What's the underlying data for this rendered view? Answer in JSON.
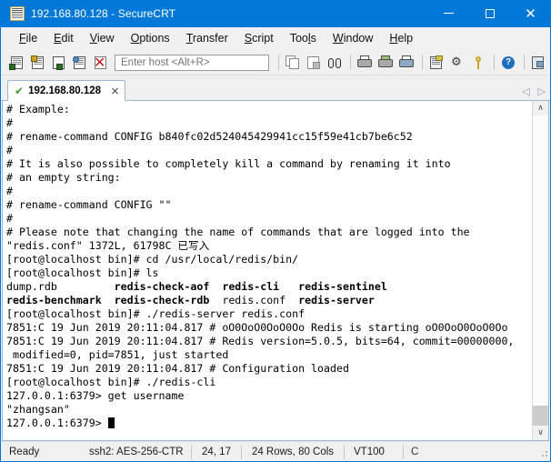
{
  "window": {
    "title": "192.168.80.128 - SecureCRT",
    "icon": "securecrt-icon",
    "minimize_label": "—",
    "maximize_label": "□",
    "close_label": "✕"
  },
  "menu": {
    "items": [
      {
        "label": "File",
        "accel": "F"
      },
      {
        "label": "Edit",
        "accel": "E"
      },
      {
        "label": "View",
        "accel": "V"
      },
      {
        "label": "Options",
        "accel": "O"
      },
      {
        "label": "Transfer",
        "accel": "T"
      },
      {
        "label": "Script",
        "accel": "S"
      },
      {
        "label": "Tools",
        "accel": "l"
      },
      {
        "label": "Window",
        "accel": "W"
      },
      {
        "label": "Help",
        "accel": "H"
      }
    ]
  },
  "toolbar": {
    "host_placeholder": "Enter host <Alt+R>",
    "host_value": "",
    "icons": [
      "new-session-icon",
      "connect-sftp-icon",
      "connect-in-tab-icon",
      "reconnect-icon",
      "disconnect-icon",
      "copy-icon",
      "paste-icon",
      "find-icon",
      "print-icon",
      "print-selection-icon",
      "print-screen-icon",
      "log-session-icon",
      "session-options-icon",
      "key-icon",
      "help-icon",
      "arrange-windows-icon"
    ]
  },
  "tabs": {
    "active": {
      "label": "192.168.80.128",
      "status_icon": "connected-check-icon",
      "close_label": "×"
    },
    "nav_prev": "◁",
    "nav_next": "▷"
  },
  "terminal": {
    "lines": [
      {
        "text": "# Example:"
      },
      {
        "text": "#"
      },
      {
        "text": "# rename-command CONFIG b840fc02d524045429941cc15f59e41cb7be6c52"
      },
      {
        "text": "#"
      },
      {
        "text": "# It is also possible to completely kill a command by renaming it into"
      },
      {
        "text": "# an empty string:"
      },
      {
        "text": "#"
      },
      {
        "text": "# rename-command CONFIG \"\""
      },
      {
        "text": "#"
      },
      {
        "text": "# Please note that changing the name of commands that are logged into the"
      },
      {
        "text": "\"redis.conf\" 1372L, 61798C 已写入"
      },
      {
        "text": "[root@localhost bin]# cd /usr/local/redis/bin/"
      },
      {
        "text": "[root@localhost bin]# ls"
      },
      {
        "segments": [
          {
            "text": "dump.rdb         ",
            "bold": false
          },
          {
            "text": "redis-check-aof",
            "bold": true
          },
          {
            "text": "  ",
            "bold": false
          },
          {
            "text": "redis-cli",
            "bold": true
          },
          {
            "text": "   ",
            "bold": false
          },
          {
            "text": "redis-sentinel",
            "bold": true
          }
        ]
      },
      {
        "segments": [
          {
            "text": "redis-benchmark",
            "bold": true
          },
          {
            "text": "  ",
            "bold": false
          },
          {
            "text": "redis-check-rdb",
            "bold": true
          },
          {
            "text": "  redis.conf  ",
            "bold": false
          },
          {
            "text": "redis-server",
            "bold": true
          }
        ]
      },
      {
        "text": "[root@localhost bin]# ./redis-server redis.conf"
      },
      {
        "text": "7851:C 19 Jun 2019 20:11:04.817 # oO0OoO0OoO0Oo Redis is starting oO0OoO0OoO0Oo"
      },
      {
        "text": "7851:C 19 Jun 2019 20:11:04.817 # Redis version=5.0.5, bits=64, commit=00000000,"
      },
      {
        "text": " modified=0, pid=7851, just started"
      },
      {
        "text": "7851:C 19 Jun 2019 20:11:04.817 # Configuration loaded"
      },
      {
        "text": "[root@localhost bin]# ./redis-cli"
      },
      {
        "text": "127.0.0.1:6379> get username"
      },
      {
        "text": "\"zhangsan\""
      },
      {
        "text": "127.0.0.1:6379> ",
        "cursor": true
      }
    ],
    "scroll_up": "∧",
    "scroll_down": "∨"
  },
  "statusbar": {
    "ready": "Ready",
    "encryption": "ssh2: AES-256-CTR",
    "position": "24, 17",
    "dimensions": "24 Rows, 80 Cols",
    "emulation": "VT100",
    "capture": "C"
  },
  "colors": {
    "titlebar": "#0078d7",
    "chrome": "#f0f0f0",
    "terminal_bg": "#ffffff",
    "terminal_fg": "#000000",
    "tab_border": "#9bb7d4",
    "check_green": "#3b9b35"
  }
}
